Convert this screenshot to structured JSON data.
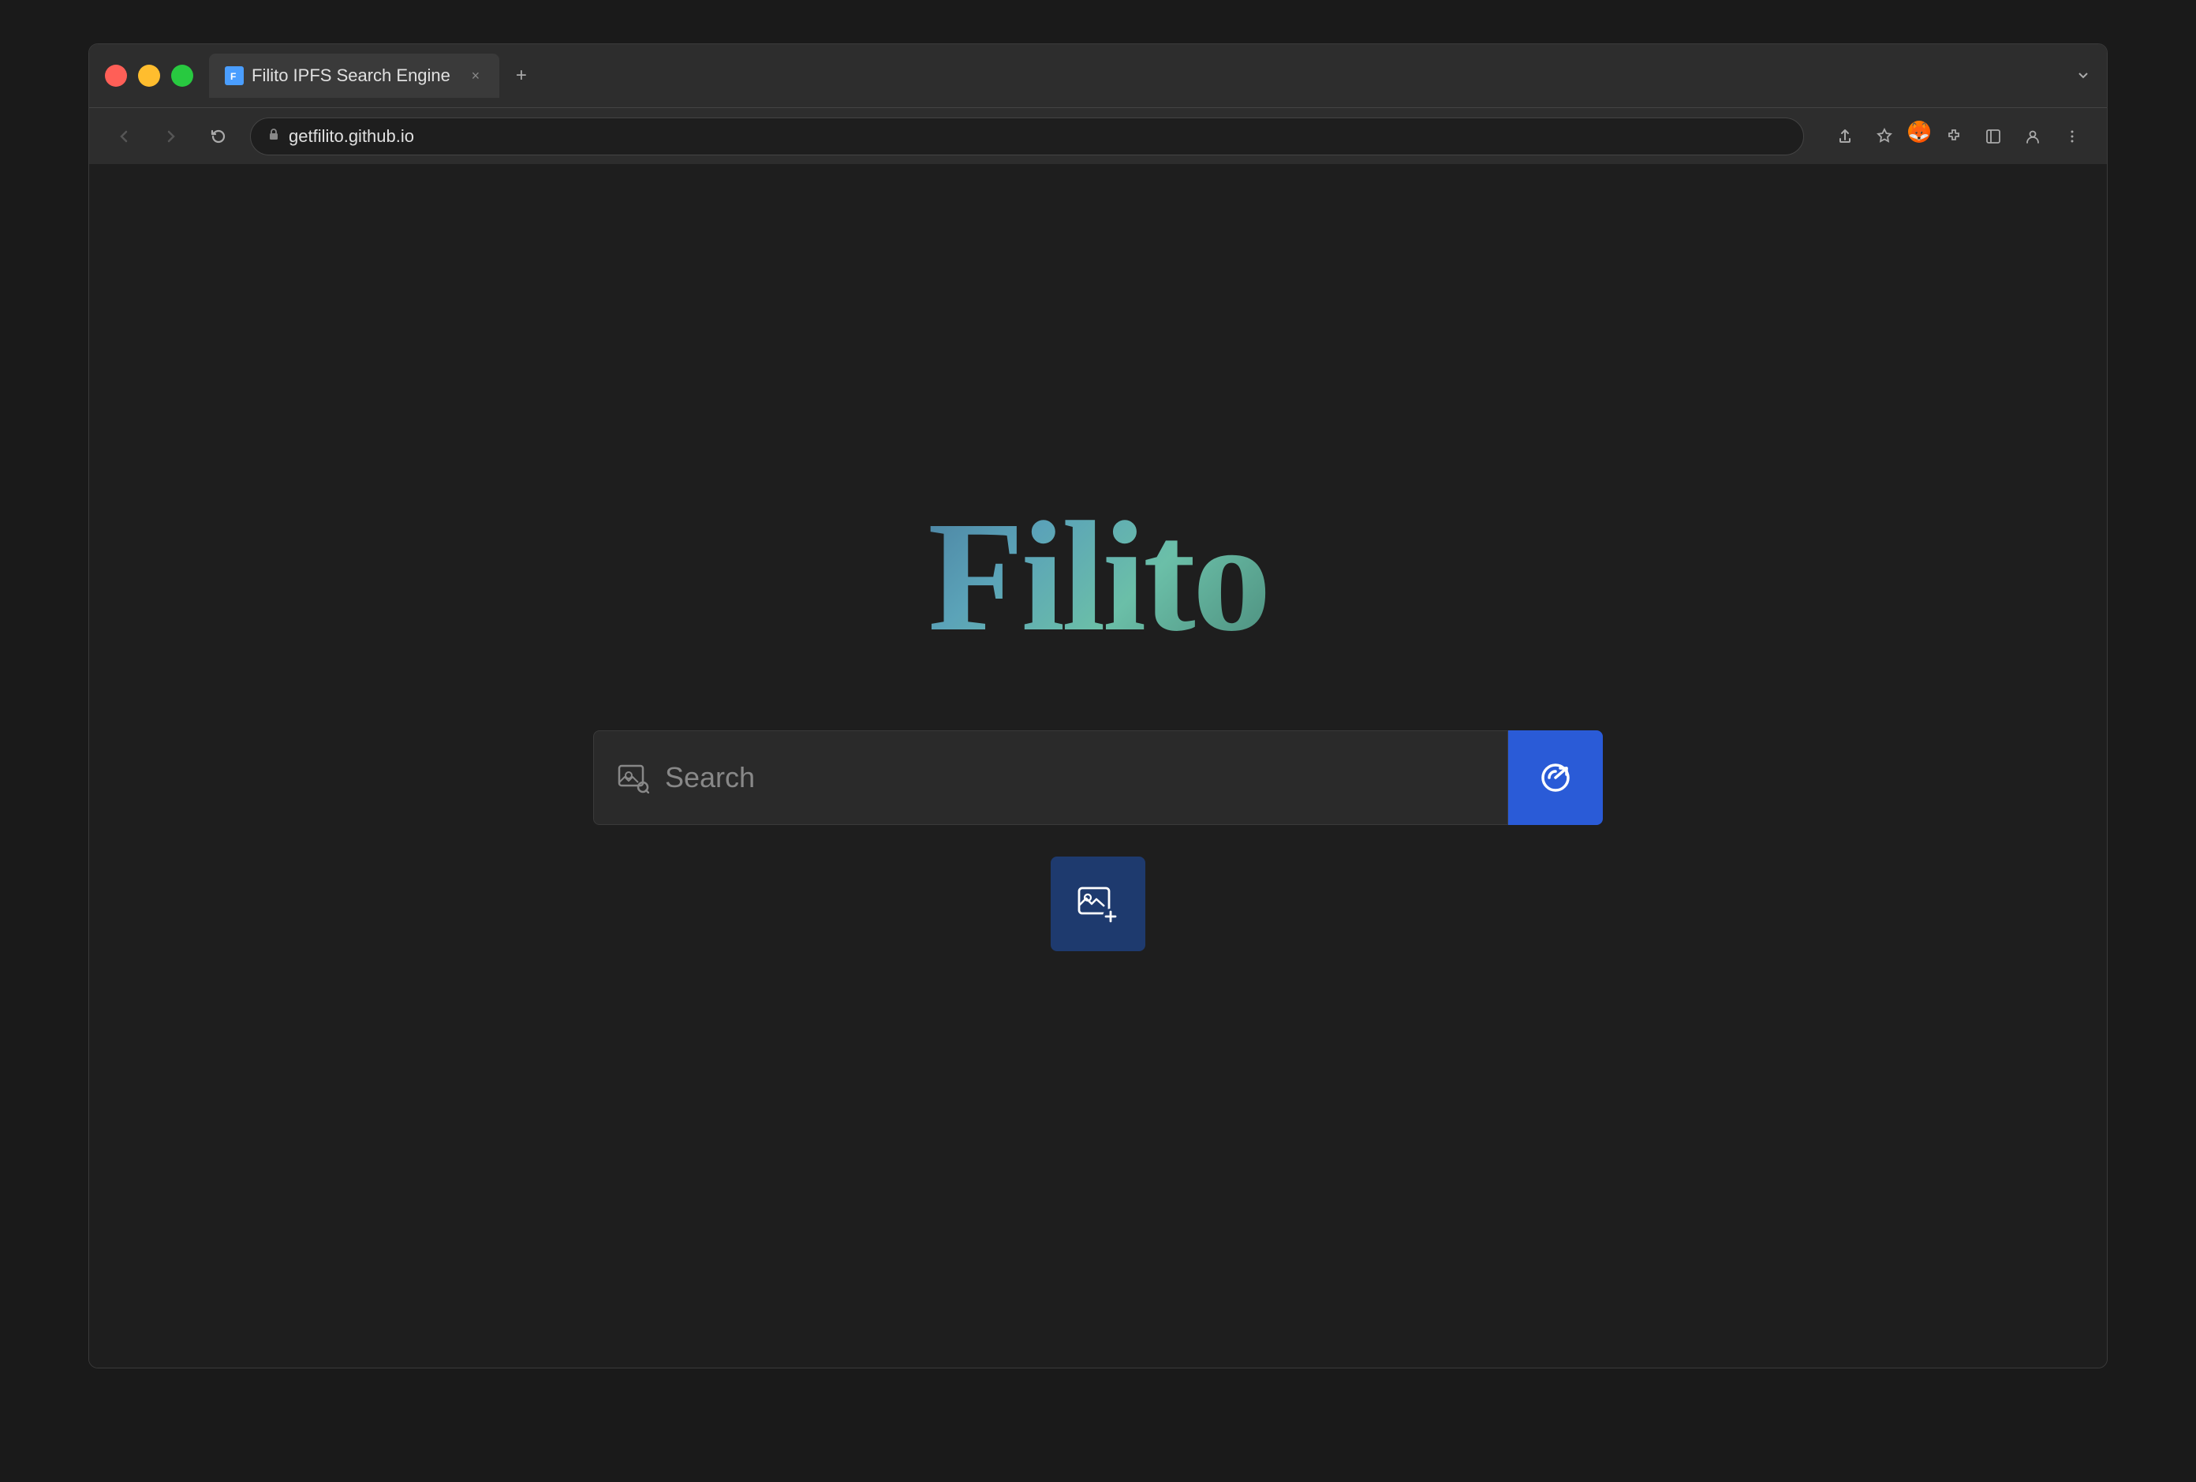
{
  "browser": {
    "title": "Filito IPFS Search Engine",
    "url": "getfilito.github.io",
    "tab": {
      "label": "Filito IPFS Search Engine",
      "favicon": "F"
    }
  },
  "app": {
    "logo": "Filito",
    "search": {
      "placeholder": "Search",
      "button_label": "Search",
      "upload_label": "Upload Image"
    }
  },
  "icons": {
    "back": "←",
    "forward": "→",
    "reload": "↻",
    "lock": "🔒",
    "share": "⬆",
    "star": "☆",
    "puzzle": "🧩",
    "sidebar": "⬜",
    "person": "👤",
    "more": "⋮",
    "tab_close": "×",
    "tab_new": "+"
  }
}
